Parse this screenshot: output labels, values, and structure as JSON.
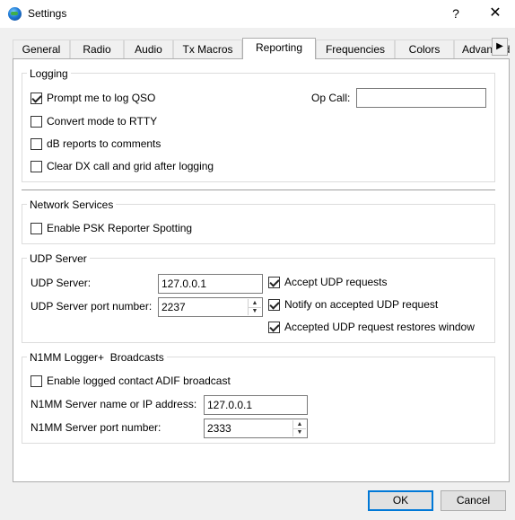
{
  "window": {
    "title": "Settings",
    "help_label": "?",
    "close_label": "✕",
    "icon": "app-globe-icon"
  },
  "tabs": [
    {
      "label": "General",
      "active": false
    },
    {
      "label": "Radio",
      "active": false
    },
    {
      "label": "Audio",
      "active": false
    },
    {
      "label": "Tx Macros",
      "active": false
    },
    {
      "label": "Reporting",
      "active": true
    },
    {
      "label": "Frequencies",
      "active": false
    },
    {
      "label": "Colors",
      "active": false
    },
    {
      "label": "Advanced",
      "active": false
    }
  ],
  "logging": {
    "title": "Logging",
    "prompt_log": {
      "label": "Prompt me to log QSO",
      "checked": true
    },
    "convert_rtty": {
      "label": "Convert mode to RTTY",
      "checked": false
    },
    "db_reports": {
      "label": "dB reports to comments",
      "checked": false
    },
    "clear_dx": {
      "label": "Clear DX call and grid after logging",
      "checked": false
    },
    "op_call": {
      "label": "Op Call:",
      "value": ""
    }
  },
  "network": {
    "title": "Network Services",
    "psk_reporter": {
      "label": "Enable PSK Reporter Spotting",
      "checked": false
    }
  },
  "udp": {
    "title": "UDP Server",
    "server_label": "UDP Server:",
    "server_value": "127.0.0.1",
    "port_label": "UDP Server port number:",
    "port_value": "2237",
    "accept": {
      "label": "Accept UDP requests",
      "checked": true
    },
    "notify": {
      "label": "Notify on accepted UDP request",
      "checked": true
    },
    "restore": {
      "label": "Accepted UDP request restores window",
      "checked": true
    }
  },
  "n1mm": {
    "title": "N1MM Logger+  Broadcasts",
    "enable": {
      "label": "Enable logged contact ADIF broadcast",
      "checked": false
    },
    "server_label": "N1MM Server name or IP address:",
    "server_value": "127.0.0.1",
    "port_label": "N1MM Server port number:",
    "port_value": "2333"
  },
  "buttons": {
    "ok": "OK",
    "cancel": "Cancel"
  }
}
